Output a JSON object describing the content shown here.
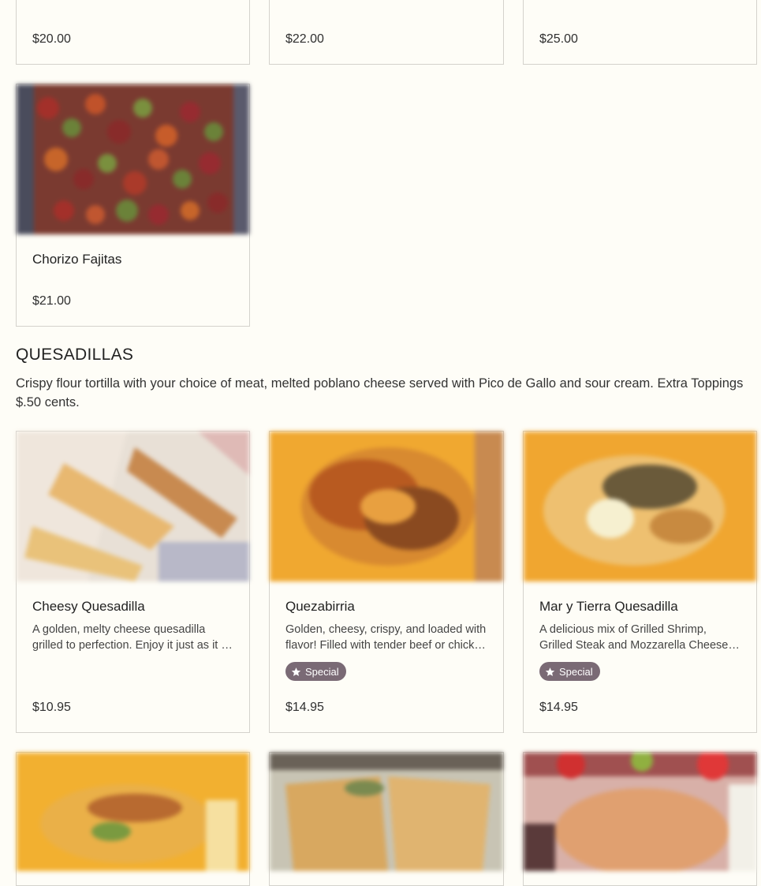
{
  "top_row": [
    {
      "price": "$20.00"
    },
    {
      "price": "$22.00"
    },
    {
      "price": "$25.00"
    }
  ],
  "fajitas": {
    "name": "Chorizo Fajitas",
    "price": "$21.00"
  },
  "section": {
    "title": "QUESADILLAS",
    "description": "Crispy flour tortilla with your choice of meat, melted poblano cheese served with Pico de Gallo and sour cream. Extra Toppings $.50 cents."
  },
  "items": [
    {
      "name": "Cheesy Quesadilla",
      "description": "A golden, melty cheese quesadilla grilled to perfection. Enjoy it just as it is, or add your favorite toppings.",
      "price": "$10.95"
    },
    {
      "name": "Quezabirria",
      "description": "Golden, cheesy, crispy, and loaded with flavor! Filled with tender beef or chicken birria.",
      "badge": "Special",
      "price": "$14.95"
    },
    {
      "name": "Mar y Tierra Quesadilla",
      "description": "A delicious mix of Grilled Shrimp, Grilled Steak and Mozzarella Cheese, served with sides.",
      "badge": "Special",
      "price": "$14.95"
    }
  ],
  "colors": {
    "background": "#fefdf7",
    "card_border": "#d4d2cc",
    "badge_bg": "#7a6a75"
  },
  "icons": {
    "badge": "star-icon"
  }
}
